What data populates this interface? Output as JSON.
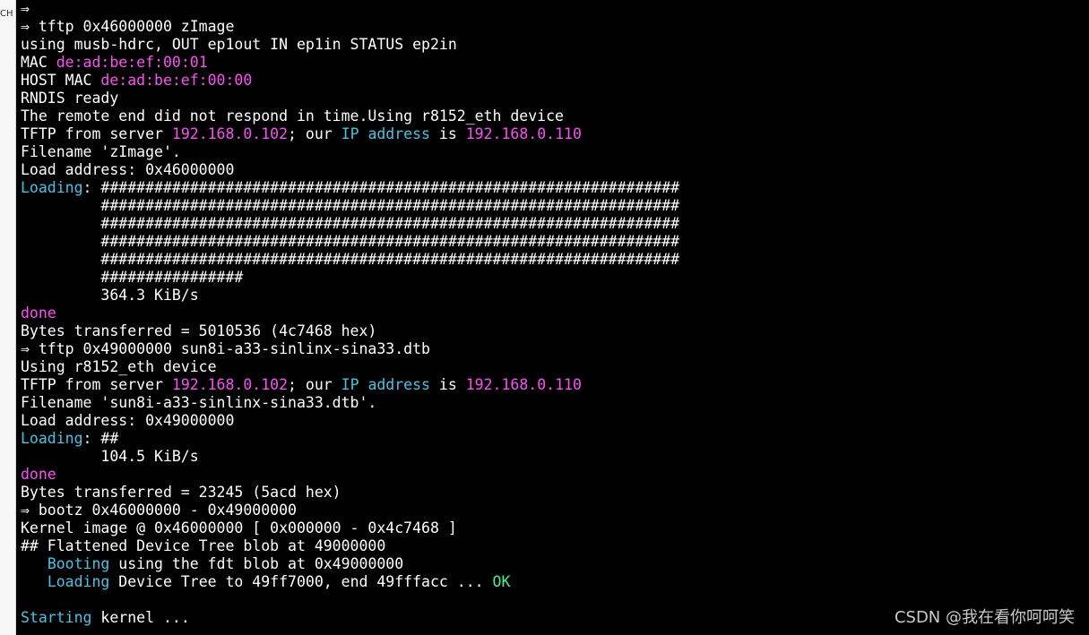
{
  "left_strip": {
    "label": "CH"
  },
  "colors": {
    "default": "#ffffff",
    "magenta": "#ff4df8",
    "cyan": "#3ec6e8",
    "green": "#3ff39b"
  },
  "terminal": {
    "lines": [
      [
        {
          "t": "⇒"
        }
      ],
      [
        {
          "t": "⇒ tftp 0x46000000 zImage"
        }
      ],
      [
        {
          "t": "using musb-hdrc, OUT ep1out IN ep1in STATUS ep2in"
        }
      ],
      [
        {
          "t": "MAC "
        },
        {
          "t": "de:ad:be:ef:00:01",
          "c": "magenta"
        }
      ],
      [
        {
          "t": "HOST MAC "
        },
        {
          "t": "de:ad:be:ef:00:00",
          "c": "magenta"
        }
      ],
      [
        {
          "t": "RNDIS ready"
        }
      ],
      [
        {
          "t": "The remote end did not respond in time.Using r8152_eth device"
        }
      ],
      [
        {
          "t": "TFTP from server "
        },
        {
          "t": "192.168.0.102",
          "c": "magenta"
        },
        {
          "t": "; our "
        },
        {
          "t": "IP address",
          "c": "cyan"
        },
        {
          "t": " is "
        },
        {
          "t": "192.168.0.110",
          "c": "magenta"
        }
      ],
      [
        {
          "t": "Filename 'zImage'."
        }
      ],
      [
        {
          "t": "Load address: 0x46000000"
        }
      ],
      [
        {
          "t": "Loading",
          "c": "cyan"
        },
        {
          "t": ": #################################################################"
        }
      ],
      [
        {
          "t": "         #################################################################"
        }
      ],
      [
        {
          "t": "         #################################################################"
        }
      ],
      [
        {
          "t": "         #################################################################"
        }
      ],
      [
        {
          "t": "         #################################################################"
        }
      ],
      [
        {
          "t": "         ################"
        }
      ],
      [
        {
          "t": "         364.3 KiB/s"
        }
      ],
      [
        {
          "t": "done",
          "c": "magenta"
        }
      ],
      [
        {
          "t": "Bytes transferred = 5010536 (4c7468 hex)"
        }
      ],
      [
        {
          "t": "⇒ tftp 0x49000000 sun8i-a33-sinlinx-sina33.dtb"
        }
      ],
      [
        {
          "t": "Using r8152_eth device"
        }
      ],
      [
        {
          "t": "TFTP from server "
        },
        {
          "t": "192.168.0.102",
          "c": "magenta"
        },
        {
          "t": "; our "
        },
        {
          "t": "IP address",
          "c": "cyan"
        },
        {
          "t": " is "
        },
        {
          "t": "192.168.0.110",
          "c": "magenta"
        }
      ],
      [
        {
          "t": "Filename 'sun8i-a33-sinlinx-sina33.dtb'."
        }
      ],
      [
        {
          "t": "Load address: 0x49000000"
        }
      ],
      [
        {
          "t": "Loading",
          "c": "cyan"
        },
        {
          "t": ": ##"
        }
      ],
      [
        {
          "t": "         104.5 KiB/s"
        }
      ],
      [
        {
          "t": "done",
          "c": "magenta"
        }
      ],
      [
        {
          "t": "Bytes transferred = 23245 (5acd hex)"
        }
      ],
      [
        {
          "t": "⇒ bootz 0x46000000 - 0x49000000"
        }
      ],
      [
        {
          "t": "Kernel image @ 0x46000000 [ 0x000000 - 0x4c7468 ]"
        }
      ],
      [
        {
          "t": "## Flattened Device Tree blob at 49000000"
        }
      ],
      [
        {
          "t": "   "
        },
        {
          "t": "Booting",
          "c": "cyan"
        },
        {
          "t": " using the fdt blob at 0x49000000"
        }
      ],
      [
        {
          "t": "   "
        },
        {
          "t": "Loading",
          "c": "cyan"
        },
        {
          "t": " Device Tree to 49ff7000, end 49fffacc ... "
        },
        {
          "t": "OK",
          "c": "green"
        }
      ],
      [
        {
          "t": ""
        }
      ],
      [
        {
          "t": "Starting",
          "c": "cyan"
        },
        {
          "t": " kernel ..."
        }
      ]
    ]
  },
  "watermark": "CSDN @我在看你呵呵笑"
}
